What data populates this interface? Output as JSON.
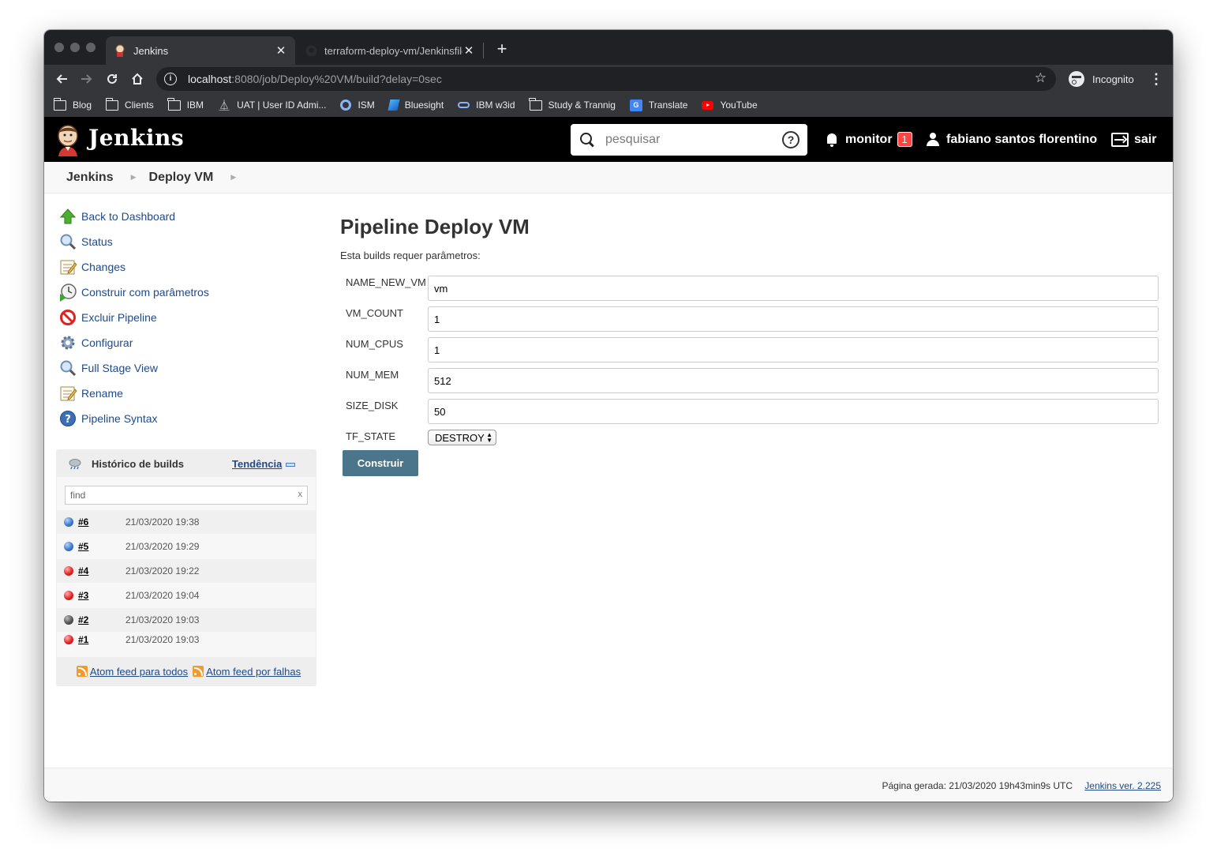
{
  "browser": {
    "tabs": [
      {
        "title": "Jenkins"
      },
      {
        "title": "terraform-deploy-vm/Jenkinsfile"
      }
    ],
    "url_host": "localhost",
    "url_rest": ":8080/job/Deploy%20VM/build?delay=0sec",
    "profile_label": "Incognito",
    "bookmarks": [
      {
        "label": "Blog",
        "icon": "folder-icon"
      },
      {
        "label": "Clients",
        "icon": "folder-icon"
      },
      {
        "label": "IBM",
        "icon": "folder-icon"
      },
      {
        "label": "UAT | User ID Admi...",
        "icon": "uat-icon"
      },
      {
        "label": "ISM",
        "icon": "ism-icon"
      },
      {
        "label": "Bluesight",
        "icon": "bluesight-icon"
      },
      {
        "label": "IBM w3id",
        "icon": "w3id-icon"
      },
      {
        "label": "Study & Trannig",
        "icon": "folder-icon"
      },
      {
        "label": "Translate",
        "icon": "translate-icon"
      },
      {
        "label": "YouTube",
        "icon": "youtube-icon"
      }
    ]
  },
  "header": {
    "title": "Jenkins",
    "search_placeholder": "pesquisar",
    "monitor_label": "monitor",
    "monitor_count": "1",
    "user_name": "fabiano santos florentino",
    "logout_label": "sair"
  },
  "breadcrumb": [
    "Jenkins",
    "Deploy VM"
  ],
  "sidebar": {
    "tasks": [
      {
        "label": "Back to Dashboard",
        "icon": "up-arrow-icon"
      },
      {
        "label": "Status",
        "icon": "magnifier-icon"
      },
      {
        "label": "Changes",
        "icon": "notepad-icon"
      },
      {
        "label": "Construir com parâmetros",
        "icon": "clock-play-icon"
      },
      {
        "label": "Excluir Pipeline",
        "icon": "no-entry-icon"
      },
      {
        "label": "Configurar",
        "icon": "gear-icon"
      },
      {
        "label": "Full Stage View",
        "icon": "magnifier-icon"
      },
      {
        "label": "Rename",
        "icon": "notepad-icon"
      },
      {
        "label": "Pipeline Syntax",
        "icon": "help-icon"
      }
    ]
  },
  "build_history": {
    "title": "Histórico de builds",
    "trend_label": "Tendência",
    "find_placeholder": "find",
    "clear_label": "x",
    "builds": [
      {
        "number": "#6",
        "date": "21/03/2020 19:38",
        "status": "blue"
      },
      {
        "number": "#5",
        "date": "21/03/2020 19:29",
        "status": "blue"
      },
      {
        "number": "#4",
        "date": "21/03/2020 19:22",
        "status": "red"
      },
      {
        "number": "#3",
        "date": "21/03/2020 19:04",
        "status": "red"
      },
      {
        "number": "#2",
        "date": "21/03/2020 19:03",
        "status": "grey"
      },
      {
        "number": "#1",
        "date": "21/03/2020 19:03",
        "status": "red"
      }
    ],
    "feed_all": "Atom feed para todos",
    "feed_failures": "Atom feed por falhas"
  },
  "main": {
    "title": "Pipeline Deploy VM",
    "intro": "Esta builds requer parâmetros:",
    "params": [
      {
        "name": "NAME_NEW_VM",
        "value": "vm"
      },
      {
        "name": "VM_COUNT",
        "value": "1"
      },
      {
        "name": "NUM_CPUS",
        "value": "1"
      },
      {
        "name": "NUM_MEM",
        "value": "512"
      },
      {
        "name": "SIZE_DISK",
        "value": "50"
      }
    ],
    "tf_state_label": "TF_STATE",
    "tf_state_value": "DESTROY",
    "build_button": "Construir"
  },
  "footer": {
    "generated": "Página gerada: 21/03/2020 19h43min9s UTC",
    "version": "Jenkins ver. 2.225"
  },
  "colors": {
    "jenkins_header": "#000000",
    "link": "#204a87",
    "build_button": "#4b758b",
    "badge": "#ff4444"
  }
}
